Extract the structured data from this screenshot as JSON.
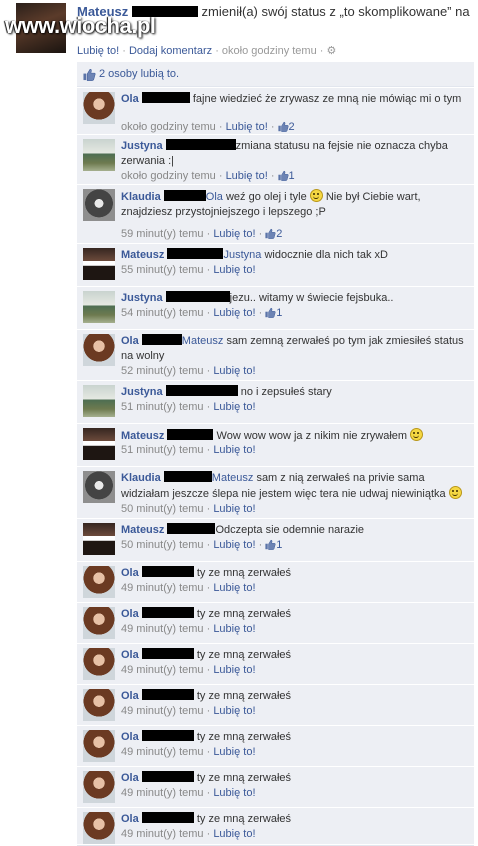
{
  "post": {
    "name": "Mateusz",
    "status_text": "zmienił(a) swój status z „to skomplikowane” na",
    "watermark": "www.wiocha.pl",
    "meta": {
      "like": "Lubię to!",
      "sep1": " · ",
      "comment": "Dodaj komentarz",
      "sep2": " · ",
      "time": "około godziny temu",
      "sep3": " · "
    }
  },
  "likes": {
    "text": "2 osoby lubią to."
  },
  "comments": [
    {
      "name": "Ola",
      "text": "fajne wiedzieć że zrywasz ze mną nie mówiąc mi o tym",
      "time": "około godziny temu",
      "like": "Lubię to!",
      "count": "2"
    },
    {
      "name": "Justyna",
      "text": "zmiana statusu na fejsie nie oznacza chyba zerwania :|",
      "time": "około godziny temu",
      "like": "Lubię to!",
      "count": "1"
    },
    {
      "name": "Klaudia",
      "mention": "Ola",
      "text": "weź go olej i tyle",
      "text2": "Nie był Ciebie wart, znajdziesz przystojniejszego i lepszego ;P",
      "time": "59 minut(y) temu",
      "like": "Lubię to!",
      "count": "2"
    },
    {
      "name": "Mateusz",
      "mention": "Justyna",
      "text": "widocznie dla nich tak xD",
      "time": "55 minut(y) temu",
      "like": "Lubię to!"
    },
    {
      "name": "Justyna",
      "text": "jezu.. witamy w świecie fejsbuka..",
      "time": "54 minut(y) temu",
      "like": "Lubię to!",
      "count": "1"
    },
    {
      "name": "Ola",
      "mention": "Mateusz",
      "text": "sam zemną zerwałeś po tym jak zmiesiłeś status na wolny",
      "time": "52 minut(y) temu",
      "like": "Lubię to!"
    },
    {
      "name": "Justyna",
      "text": "no i zepsułeś stary",
      "time": "51 minut(y) temu",
      "like": "Lubię to!"
    },
    {
      "name": "Mateusz",
      "text": "Wow wow wow ja z nikim nie zrywałem",
      "time": "51 minut(y) temu",
      "like": "Lubię to!"
    },
    {
      "name": "Klaudia",
      "mention": "Mateusz",
      "text": "sam z nią zerwałeś na privie sama widziałam jeszcze ślepa nie jestem więc tera nie udwaj niewiniątka",
      "time": "50 minut(y) temu",
      "like": "Lubię to!"
    },
    {
      "name": "Mateusz",
      "text": "Odczepta sie odemnie narazie",
      "time": "50 minut(y) temu",
      "like": "Lubię to!",
      "count": "1"
    },
    {
      "name": "Ola",
      "text": "ty ze mną zerwałeś",
      "time": "49 minut(y) temu",
      "like": "Lubię to!"
    },
    {
      "name": "Ola",
      "text": "ty ze mną zerwałeś",
      "time": "49 minut(y) temu",
      "like": "Lubię to!"
    },
    {
      "name": "Ola",
      "text": "ty ze mną zerwałeś",
      "time": "49 minut(y) temu",
      "like": "Lubię to!"
    },
    {
      "name": "Ola",
      "text": "ty ze mną zerwałeś",
      "time": "49 minut(y) temu",
      "like": "Lubię to!"
    },
    {
      "name": "Ola",
      "text": "ty ze mną zerwałeś",
      "time": "49 minut(y) temu",
      "like": "Lubię to!"
    },
    {
      "name": "Ola",
      "text": "ty ze mną zerwałeś",
      "time": "49 minut(y) temu",
      "like": "Lubię to!"
    },
    {
      "name": "Ola",
      "text": "ty ze mną zerwałeś",
      "time": "49 minut(y) temu",
      "like": "Lubię to!"
    }
  ]
}
